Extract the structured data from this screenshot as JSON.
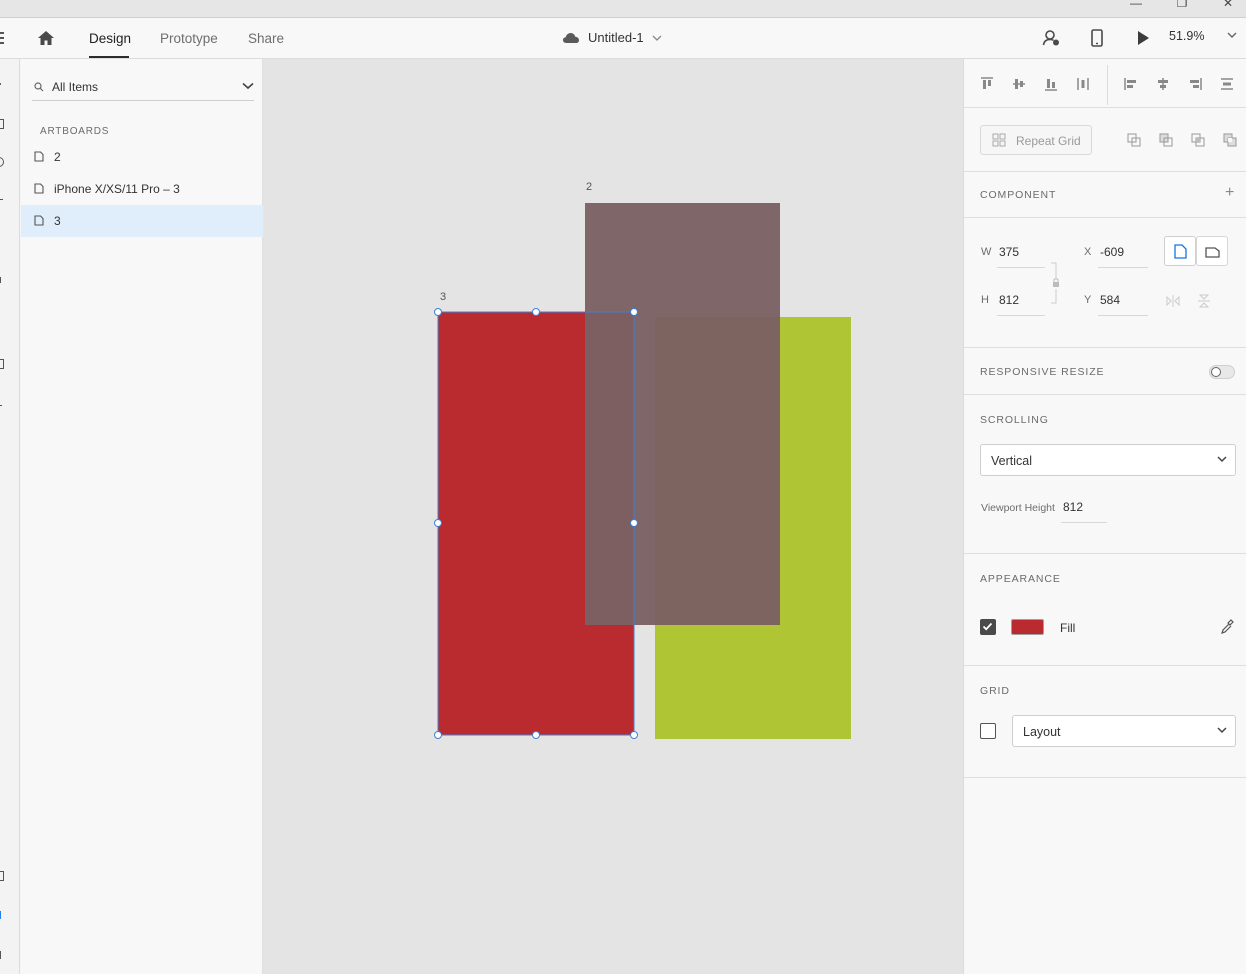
{
  "window": {
    "minimize_glyph": "—",
    "restore_glyph": "❐",
    "close_glyph": "✕"
  },
  "toolbar": {
    "tabs": [
      {
        "label": "Design",
        "active": true
      },
      {
        "label": "Prototype",
        "active": false
      },
      {
        "label": "Share",
        "active": false
      }
    ],
    "document_title": "Untitled-1",
    "zoom": "51.9%"
  },
  "layers": {
    "search_label": "All Items",
    "section_title": "ARTBOARDS",
    "items": [
      {
        "label": "2",
        "selected": false
      },
      {
        "label": "iPhone X/XS/11 Pro – 3",
        "selected": false
      },
      {
        "label": "3",
        "selected": true
      }
    ]
  },
  "canvas": {
    "artboards": [
      {
        "label": "2",
        "fill": "#7b6163"
      },
      {
        "label": "3",
        "fill": "#b92b2f"
      },
      {
        "label": "",
        "fill": "#afc534"
      }
    ]
  },
  "inspector": {
    "repeat_grid_label": "Repeat Grid",
    "component_title": "COMPONENT",
    "component_add": "+",
    "w_label": "W",
    "w_value": "375",
    "h_label": "H",
    "h_value": "812",
    "x_label": "X",
    "x_value": "-609",
    "y_label": "Y",
    "y_value": "584",
    "responsive_title": "RESPONSIVE RESIZE",
    "responsive_on": false,
    "scrolling_title": "SCROLLING",
    "scrolling_value": "Vertical",
    "viewport_label": "Viewport Height",
    "viewport_value": "812",
    "appearance_title": "APPEARANCE",
    "fill_label": "Fill",
    "fill_checked": true,
    "fill_color": "#b92b2f",
    "grid_title": "GRID",
    "grid_value": "Layout",
    "grid_checked": false
  }
}
